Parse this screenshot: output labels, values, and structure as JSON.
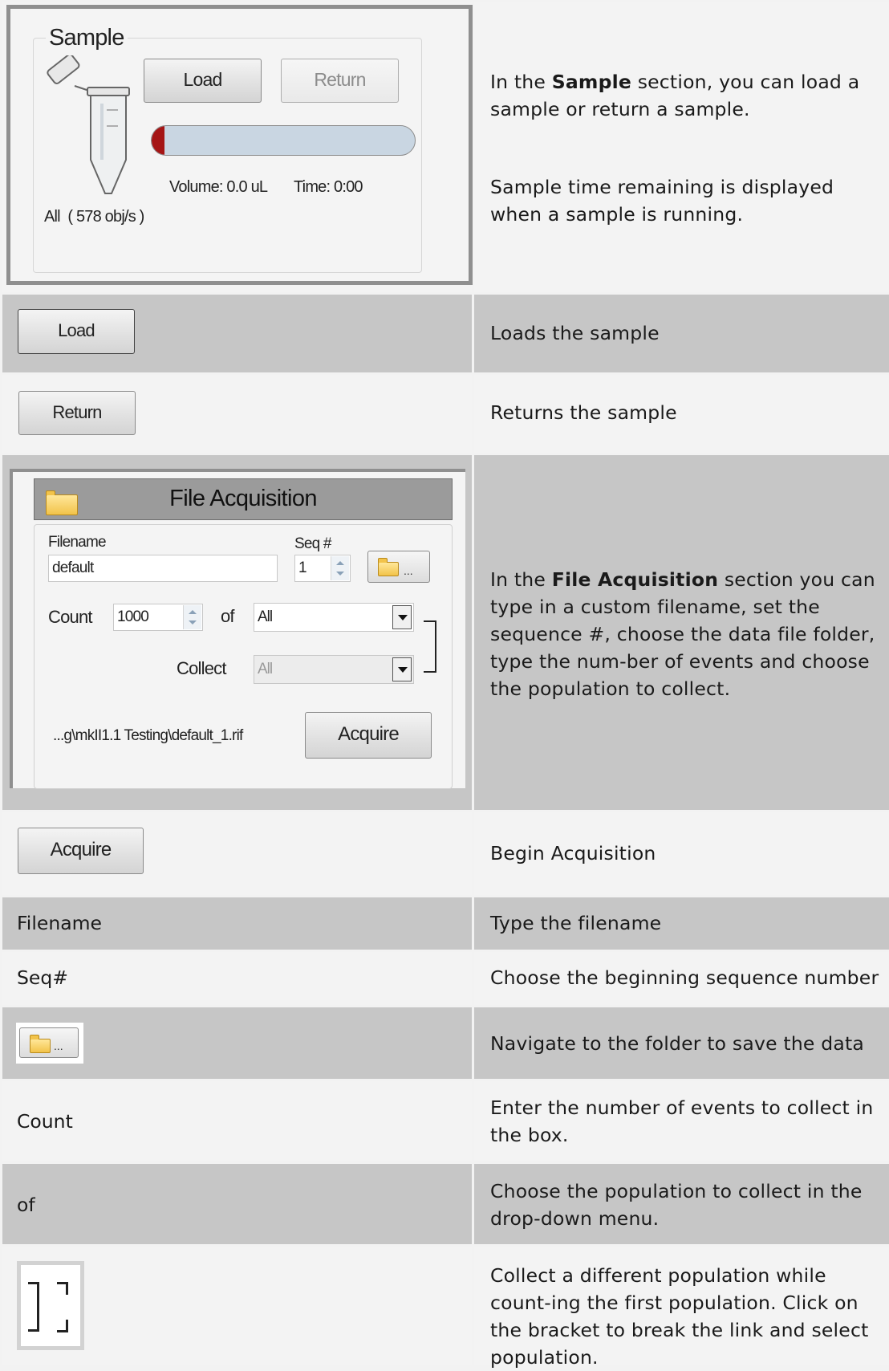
{
  "sample_panel": {
    "title": "Sample",
    "load_label": "Load",
    "return_label": "Return",
    "progress_fraction": 0.05,
    "volume_text": "Volume: 0.0 uL",
    "time_text": "Time: 0:00",
    "rate_text": "All  ( 578 obj/s )"
  },
  "row_sample": {
    "desc_pre": "In the ",
    "desc_bold": "Sample",
    "desc_post": " section, you can load a sample or return a sample.",
    "desc2": "Sample time remaining is displayed when a sample is running."
  },
  "row_load": {
    "button_label": "Load",
    "desc": "Loads the sample"
  },
  "row_return": {
    "button_label": "Return",
    "desc": "Returns the sample"
  },
  "fa_panel": {
    "title": "File Acquisition",
    "filename_label": "Filename",
    "filename_value": "default",
    "seq_label": "Seq #",
    "seq_value": "1",
    "folder_dots": "...",
    "count_label": "Count",
    "count_value": "1000",
    "of_label": "of",
    "of_value": "All",
    "collect_label": "Collect",
    "collect_value": "All",
    "path_text": "...g\\mkII1.1 Testing\\default_1.rif",
    "acquire_label": "Acquire"
  },
  "row_fa": {
    "desc_pre": "In the ",
    "desc_bold": "File Acquisition",
    "desc_post": " section you can type in a custom filename, set the sequence #, choose the data file folder, type the num-ber of events and choose the population to collect."
  },
  "row_acquire": {
    "button_label": "Acquire",
    "desc": "Begin Acquisition"
  },
  "row_filename": {
    "label": "Filename",
    "desc": "Type the filename"
  },
  "row_seq": {
    "label": "Seq#",
    "desc": "Choose the beginning sequence number"
  },
  "row_folder": {
    "dots": "...",
    "desc": "Navigate to the folder to save the data"
  },
  "row_count": {
    "label": "Count",
    "desc": "Enter the number of events to collect in the box."
  },
  "row_of": {
    "label": "of",
    "desc": "Choose the population to collect in the drop-down menu."
  },
  "row_bracket": {
    "desc": "Collect a different population while count-ing the first population. Click on the bracket to break the link and select population."
  }
}
